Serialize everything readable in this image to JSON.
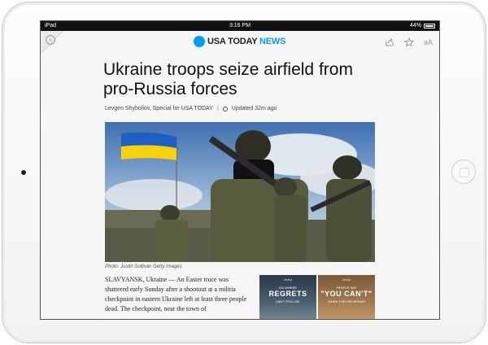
{
  "status_bar": {
    "carrier": "iPad",
    "time": "3:16 PM",
    "battery": "44%"
  },
  "app_bar": {
    "logo_text": "USA TODAY",
    "logo_section": "NEWS",
    "font_size_label": "aA"
  },
  "article": {
    "headline": "Ukraine troops seize airfield from pro-Russia forces",
    "byline_author": "Levgen Shybollov, Special for USA TODAY",
    "byline_sep": "|",
    "updated": "Updated 32m ago",
    "photo_caption": "Photo: Justin Sullivan Getty Images",
    "body": "SLAVYANSK, Ukraine — An Easter truce was shattered early Sunday after a shootout at a militia checkpoint in eastern Ukraine left at least three people dead. The checkpoint, near the town of"
  },
  "ad": {
    "panel1_brand": "Jeep",
    "panel1_small": "GO WHERE",
    "panel1_big": "REGRETS",
    "panel1_tag": "CAN'T FOLLOW.",
    "panel2_brand": "Jeep",
    "panel2_small": "PEOPLE SAY",
    "panel2_big": "\"YOU CAN'T\"",
    "panel2_tag": "WHEN THEY'RE AFRAID"
  },
  "colors": {
    "brand_blue": "#009bff",
    "screen_bg": "#f6f6f6",
    "status_bar_bg": "#111111"
  }
}
